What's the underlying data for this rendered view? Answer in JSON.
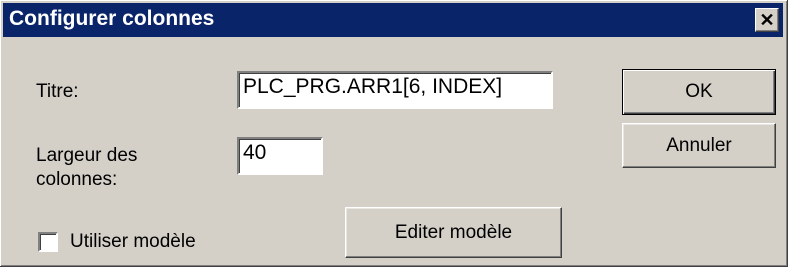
{
  "window": {
    "title": "Configurer colonnes",
    "close_glyph": "✕",
    "colors": {
      "titlebar": "#0a246a",
      "face": "#d4d0c8"
    }
  },
  "form": {
    "titre_label": "Titre:",
    "titre_value": "PLC_PRG.ARR1[6, INDEX]",
    "largeur_label_line1": "Largeur des",
    "largeur_label_line2": "colonnes:",
    "largeur_value": "40",
    "use_template_label": "Utiliser modèle",
    "use_template_checked": false
  },
  "buttons": {
    "ok": "OK",
    "cancel": "Annuler",
    "edit_template": "Editer modèle"
  }
}
